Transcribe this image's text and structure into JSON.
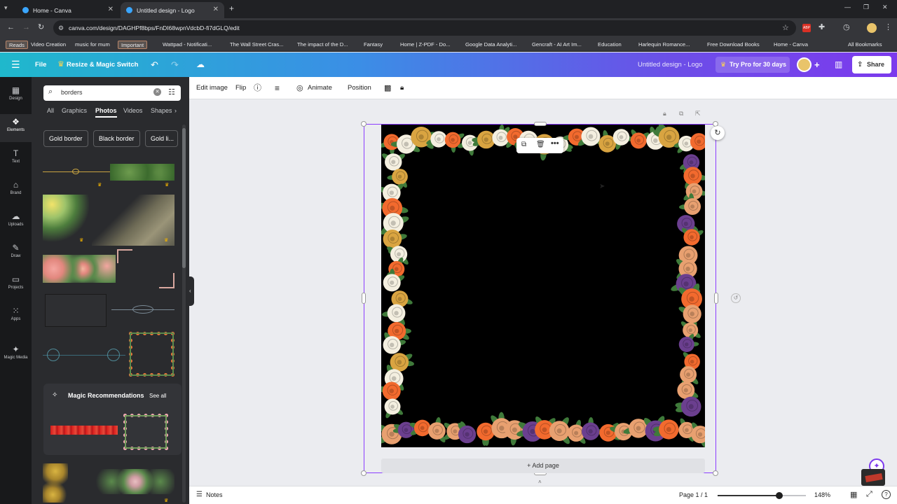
{
  "browser": {
    "tabs": [
      {
        "label": "Home - Canva",
        "active": false
      },
      {
        "label": "Untitled design - Logo",
        "active": true
      }
    ],
    "new_tab_label": "+",
    "url": "canva.com/design/DAGHPf8bps/FnDI68wpnVdcbD-fi7dGLQ/edit",
    "bookmarks": [
      {
        "label": "Reads",
        "style": "tag"
      },
      {
        "label": "Video Creation",
        "style": "tag"
      },
      {
        "label": "music for mum",
        "style": "tag"
      },
      {
        "label": "Important",
        "style": "tag"
      },
      {
        "label": "Wattpad - Notificati..."
      },
      {
        "label": "The Wall Street Cras..."
      },
      {
        "label": "The impact of the D..."
      },
      {
        "label": "Fantasy"
      },
      {
        "label": "Home | Z-PDF - Do..."
      },
      {
        "label": "Google Data Analyti..."
      },
      {
        "label": "Gencraft - AI Art Im..."
      },
      {
        "label": "Education"
      },
      {
        "label": "Harlequin Romance..."
      },
      {
        "label": "Free Download Books"
      },
      {
        "label": "Home - Canva"
      },
      {
        "label": "All Bookmarks"
      }
    ]
  },
  "canva_header": {
    "file": "File",
    "resize": "Resize & Magic Switch",
    "design_title": "Untitled design - Logo",
    "try_pro": "Try Pro for 30 days",
    "share": "Share"
  },
  "rail": [
    {
      "label": "Design",
      "icon": "design-icon"
    },
    {
      "label": "Elements",
      "icon": "elements-icon",
      "active": true
    },
    {
      "label": "Text",
      "icon": "text-icon"
    },
    {
      "label": "Brand",
      "icon": "brand-icon"
    },
    {
      "label": "Uploads",
      "icon": "uploads-icon"
    },
    {
      "label": "Draw",
      "icon": "draw-icon"
    },
    {
      "label": "Projects",
      "icon": "projects-icon"
    },
    {
      "label": "Apps",
      "icon": "apps-icon"
    },
    {
      "label": "Magic Media",
      "icon": "magic-media-icon"
    }
  ],
  "panel": {
    "search_value": "borders",
    "tabs": [
      "All",
      "Graphics",
      "Photos",
      "Videos",
      "Shapes"
    ],
    "active_tab": "Photos",
    "chips": [
      "Gold border",
      "Black border",
      "Gold li..."
    ],
    "magic_title": "Magic Recommendations",
    "see_all": "See all"
  },
  "toolbar": {
    "edit_image": "Edit image",
    "flip": "Flip",
    "animate": "Animate",
    "position": "Position"
  },
  "canvas": {
    "add_page": "+ Add page"
  },
  "bottom": {
    "notes": "Notes",
    "page": "Page 1 / 1",
    "zoom": "148%",
    "zoom_level": 0.7
  },
  "colors": {
    "accent": "#8b3dff",
    "rose_orange": "#f26a2e",
    "rose_peach": "#e8a070",
    "rose_cream": "#f4efe0",
    "rose_purple": "#6b3f8f",
    "rose_gold": "#d9a441",
    "leaf": "#3f7a3a"
  }
}
